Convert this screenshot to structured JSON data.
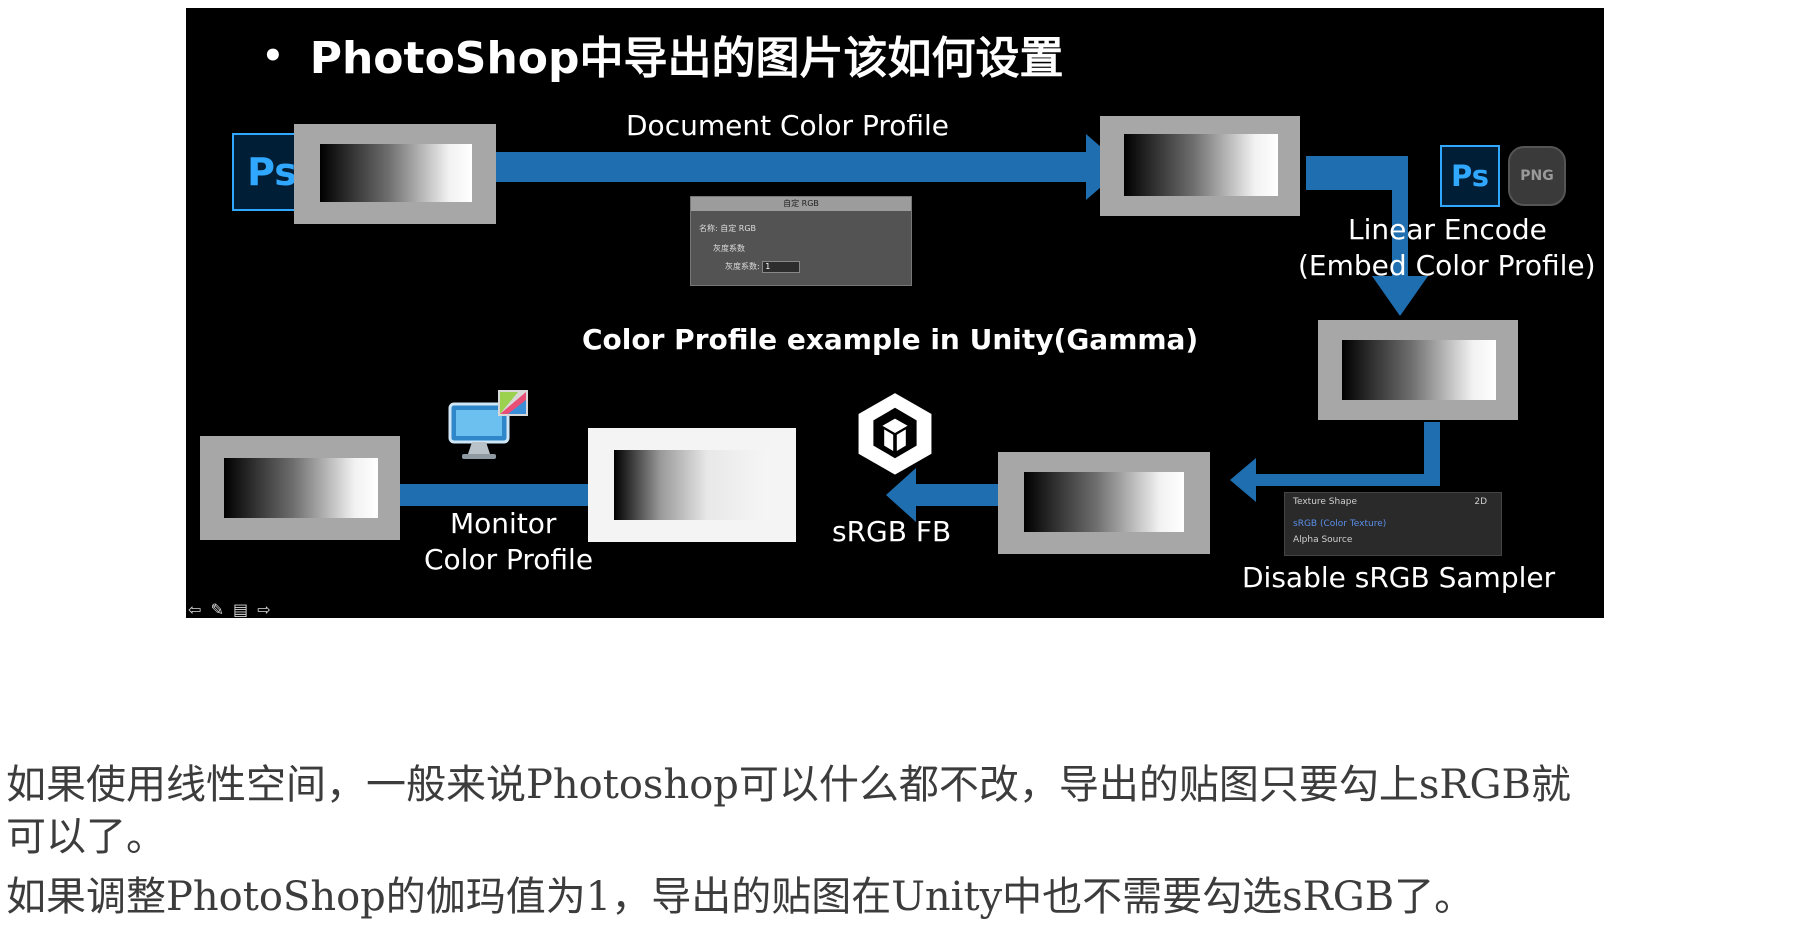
{
  "slide": {
    "bullet": "•",
    "title": "PhotoShop中导出的图片该如何设置",
    "ps_icon_text": "Ps",
    "png_icon_text": "PNG",
    "labels": {
      "document_color_profile": "Document Color Profile",
      "linear_encode": "Linear Encode",
      "embed_color_profile": "(Embed Color Profile)",
      "color_profile_example": "Color Profile example in Unity(Gamma)",
      "disable_srgb_sampler": "Disable sRGB Sampler",
      "srgb_fb": "sRGB FB",
      "monitor": "Monitor",
      "color_profile": "Color Profile"
    },
    "dialog": {
      "title": "自定 RGB",
      "name_label": "名称:",
      "name_value": "自定 RGB",
      "gamma_group": "灰度系数",
      "gamma_label": "灰度系数:",
      "gamma_value": "1"
    },
    "inspector": {
      "texture_shape": "Texture Shape",
      "texture_shape_value": "2D",
      "srgb": "sRGB (Color Texture)",
      "alpha_source": "Alpha Source"
    },
    "nav_icons": "⇦ ✎ ▤ ⇨"
  },
  "body": {
    "line1": "如果使用线性空间，一般来说Photoshop可以什么都不改，导出的贴图只要勾上sRGB就",
    "line2": "可以了。",
    "line3": "如果调整PhotoShop的伽玛值为1，导出的贴图在Unity中也不需要勾选sRGB了。"
  },
  "colors": {
    "arrow": "#1f6fb0",
    "ps_blue": "#31a8ff",
    "frame_gray": "#a7a7a7",
    "slide_bg": "#000000",
    "body_text": "#3c3c3c"
  }
}
